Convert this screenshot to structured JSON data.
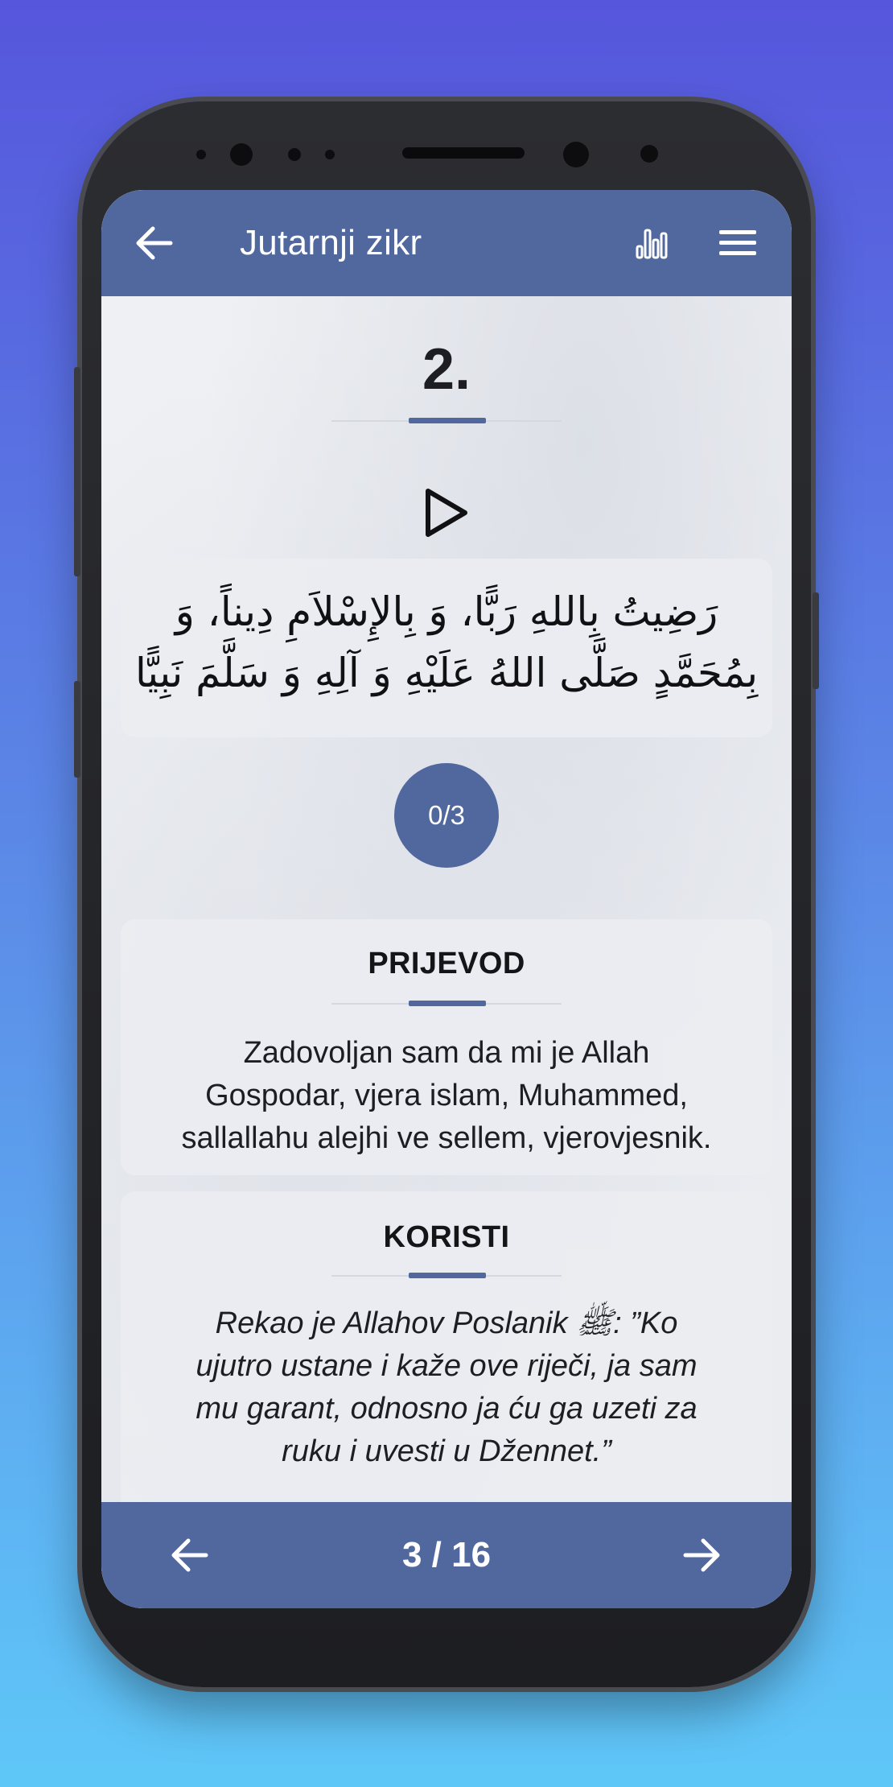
{
  "header": {
    "title": "Jutarnji zikr",
    "icons": [
      "arrow-left-icon",
      "bar-chart-icon",
      "hamburger-menu-icon"
    ]
  },
  "dhikr": {
    "number": "2.",
    "arabic_line1": "رَضِيتُ بِاللهِ رَبًّا، وَ بِالإِسْلاَمِ دِيناً، وَ",
    "arabic_line2": "بِمُحَمَّدٍ صَلَّى اللهُ عَلَيْهِ وَ آلِهِ وَ سَلَّمَ نَبِيًّا",
    "counter": "0/3"
  },
  "translation": {
    "heading": "PRIJEVOD",
    "line1": "Zadovoljan sam da mi je Allah",
    "line2": "Gospodar, vjera islam, Muhammed,",
    "line3": "sallallahu alejhi ve sellem, vjerovjesnik."
  },
  "benefits": {
    "heading": "KORISTI",
    "line1": "Rekao je Allahov Poslanik ﷺ: ”Ko",
    "line2": "ujutro ustane i kaže ove riječi, ja sam",
    "line3": "mu garant, odnosno ja ću ga uzeti za",
    "line4": "ruku i uvesti u Džennet.”"
  },
  "footer": {
    "page_indicator": "3 / 16",
    "icons": [
      "arrow-left-icon",
      "arrow-right-icon"
    ]
  },
  "colors": {
    "accent": "#51689f",
    "background_top": "#5656dc",
    "background_bottom": "#5fc7f8"
  }
}
